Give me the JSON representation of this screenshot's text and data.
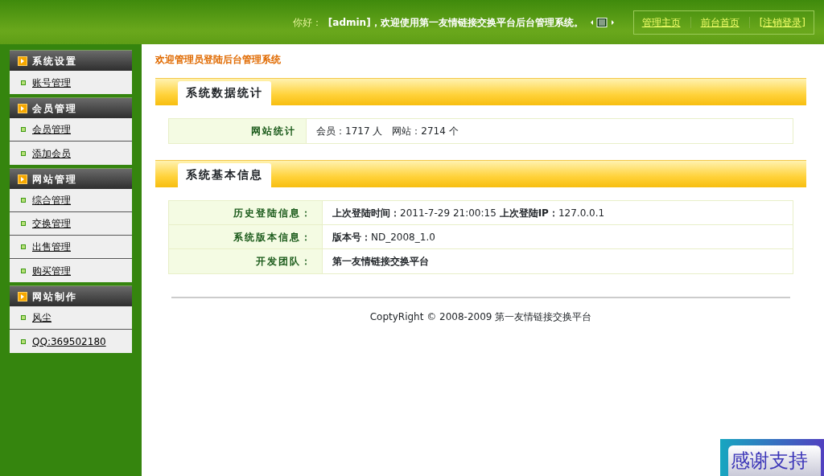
{
  "header": {
    "greeting": "你好：",
    "welcome": "[admin]，欢迎使用第一友情链接交换平台后台管理系统。",
    "links": [
      "管理主页",
      "前台首页",
      "[注销登录]"
    ]
  },
  "sidebar": {
    "groups": [
      {
        "title": "系统设置",
        "items": [
          "账号管理"
        ]
      },
      {
        "title": "会员管理",
        "items": [
          "会员管理",
          "添加会员"
        ]
      },
      {
        "title": "网站管理",
        "items": [
          "综合管理",
          "交换管理",
          "出售管理",
          "购买管理"
        ]
      },
      {
        "title": "网站制作",
        "items": [
          "风尘",
          "QQ:369502180"
        ]
      }
    ]
  },
  "main": {
    "page_title": "欢迎管理员登陆后台管理系统",
    "sections": [
      {
        "title": "系统数据统计",
        "rows": [
          {
            "label": "网站统计",
            "value": "会员：1717 人　网站：2714 个",
            "bold": false
          }
        ]
      },
      {
        "title": "系统基本信息",
        "rows": [
          {
            "label": "历史登陆信息：",
            "value": "**上次登陆时间：**2011-7-29 21:00:15  **上次登陆IP：**127.0.0.1",
            "bold": false
          },
          {
            "label": "系统版本信息：",
            "value": "**版本号：**ND_2008_1.0",
            "bold": false
          },
          {
            "label": "开发团队：",
            "value": "第一友情链接交换平台",
            "bold": true
          }
        ]
      }
    ],
    "footer": "CoptyRight © 2008-2009 第一友情链接交换平台"
  },
  "thanks_badge": "感谢支持"
}
